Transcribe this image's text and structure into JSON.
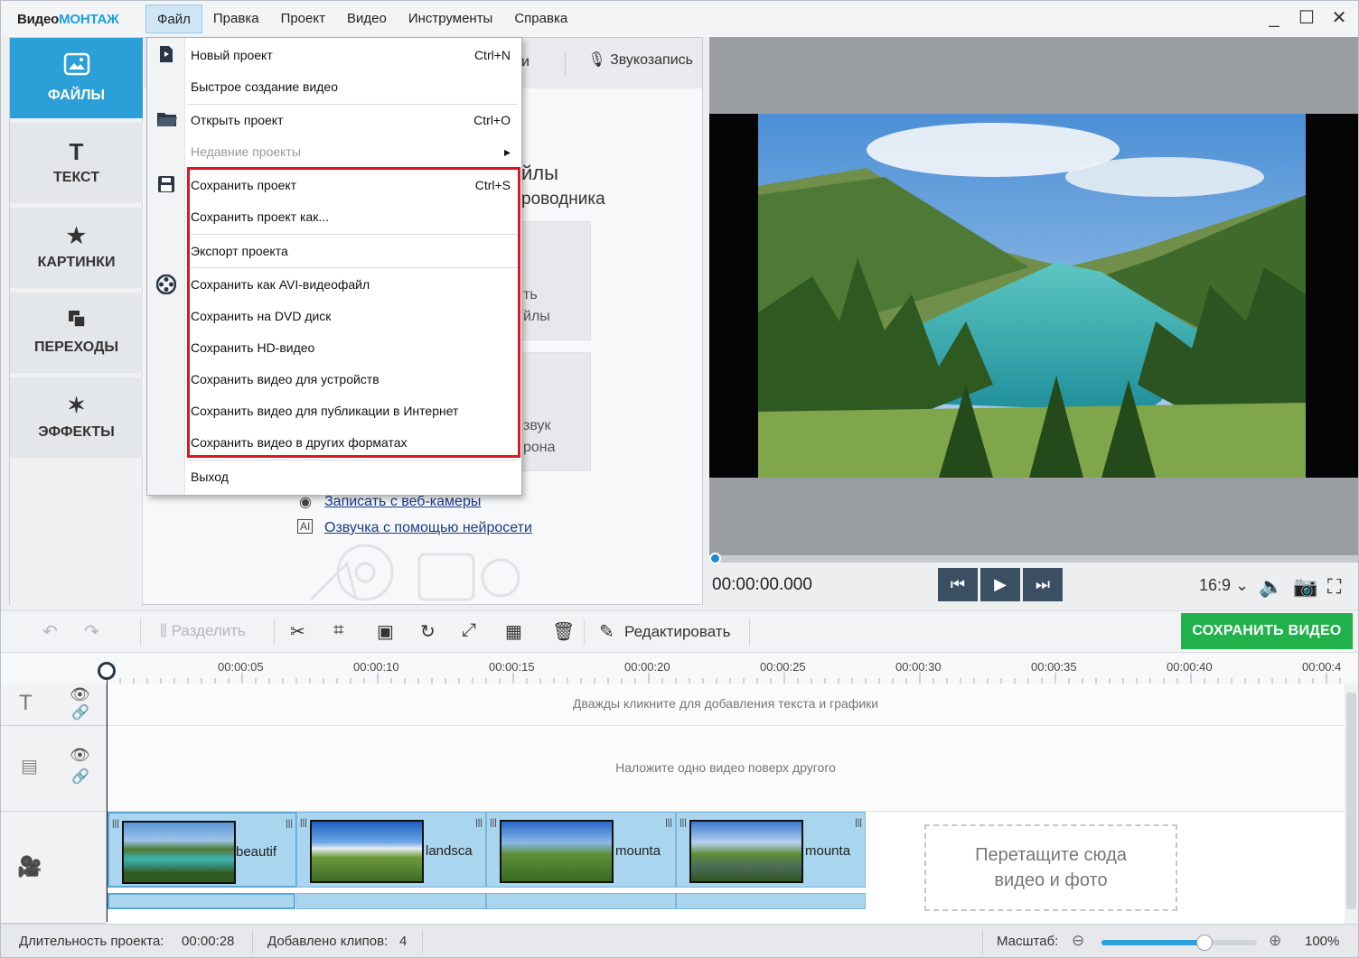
{
  "app": {
    "logo_part1": "Видео",
    "logo_part2": "МОНТАЖ"
  },
  "menubar": {
    "items": [
      "Файл",
      "Правка",
      "Проект",
      "Видео",
      "Инструменты",
      "Справка"
    ],
    "active": "Файл"
  },
  "window_controls": {
    "minimize": "_",
    "maximize": "☐",
    "close": "✕"
  },
  "sidetabs": [
    {
      "label": "ФАЙЛЫ",
      "icon": "image-icon",
      "active": true
    },
    {
      "label": "ТЕКСТ",
      "icon": "text-icon",
      "active": false
    },
    {
      "label": "КАРТИНКИ",
      "icon": "star-icon",
      "active": false
    },
    {
      "label": "ПЕРЕХОДЫ",
      "icon": "transitions-icon",
      "active": false
    },
    {
      "label": "ЭФФЕКТЫ",
      "icon": "magic-wand-icon",
      "active": false
    }
  ],
  "panel": {
    "subtab_partial": "и",
    "record_label": "Звукозапись",
    "heading_partial": "йлы",
    "subheading_partial": "роводника",
    "card1_line1": "ть",
    "card1_line2": "йлы",
    "card2_line1": "звук",
    "card2_line2": "рона",
    "link_webcam": "Записать с веб-камеры",
    "link_ai_voice": "Озвучка с помощью нейросети"
  },
  "file_menu": {
    "items": [
      {
        "label": "Новый проект",
        "shortcut": "Ctrl+N"
      },
      {
        "label": "Быстрое создание видео",
        "shortcut": ""
      },
      {
        "label": "Открыть проект",
        "shortcut": "Ctrl+O"
      },
      {
        "label": "Недавние проекты",
        "shortcut": "▸",
        "disabled": true
      },
      {
        "label": "Сохранить проект",
        "shortcut": "Ctrl+S"
      },
      {
        "label": "Сохранить проект как...",
        "shortcut": ""
      },
      {
        "label": "Экспорт проекта",
        "shortcut": ""
      },
      {
        "label": "Сохранить как AVI-видеофайл",
        "shortcut": ""
      },
      {
        "label": "Сохранить на DVD диск",
        "shortcut": ""
      },
      {
        "label": "Сохранить HD-видео",
        "shortcut": ""
      },
      {
        "label": "Сохранить видео для устройств",
        "shortcut": ""
      },
      {
        "label": "Сохранить видео для публикации в Интернет",
        "shortcut": ""
      },
      {
        "label": "Сохранить видео в других форматах",
        "shortcut": ""
      },
      {
        "label": "Выход",
        "shortcut": ""
      }
    ]
  },
  "preview": {
    "timecode": "00:00:00.000",
    "position_fraction": 0,
    "aspect": "16:9 ⌄"
  },
  "toolbar": {
    "split_label": "Разделить",
    "edit_label": "Редактировать",
    "save_video_label": "СОХРАНИТЬ ВИДЕО"
  },
  "timeline": {
    "ticks": [
      "00:00:05",
      "00:00:10",
      "00:00:15",
      "00:00:20",
      "00:00:25",
      "00:00:30",
      "00:00:35",
      "00:00:40",
      "00:00:4"
    ],
    "text_track_hint": "Дважды кликните для добавления текста и графики",
    "overlay_track_hint": "Наложите одно видео поверх другого",
    "clips": [
      {
        "label": "beautif",
        "selected": true
      },
      {
        "label": "landsca",
        "selected": false
      },
      {
        "label": "mounta",
        "selected": false
      },
      {
        "label": "mounta",
        "selected": false
      }
    ],
    "dropzone_line1": "Перетащите сюда",
    "dropzone_line2": "видео и фото"
  },
  "statusbar": {
    "duration_label": "Длительность проекта:",
    "duration_value": "00:00:28",
    "clips_added_label": "Добавлено клипов:",
    "clips_added_value": "4",
    "zoom_label": "Масштаб:",
    "zoom_value": "100%",
    "zoom_level_fraction": 0.66
  },
  "colors": {
    "accent": "#2a9fd8",
    "save_green": "#22b24c",
    "highlight_red": "#e0161e"
  }
}
